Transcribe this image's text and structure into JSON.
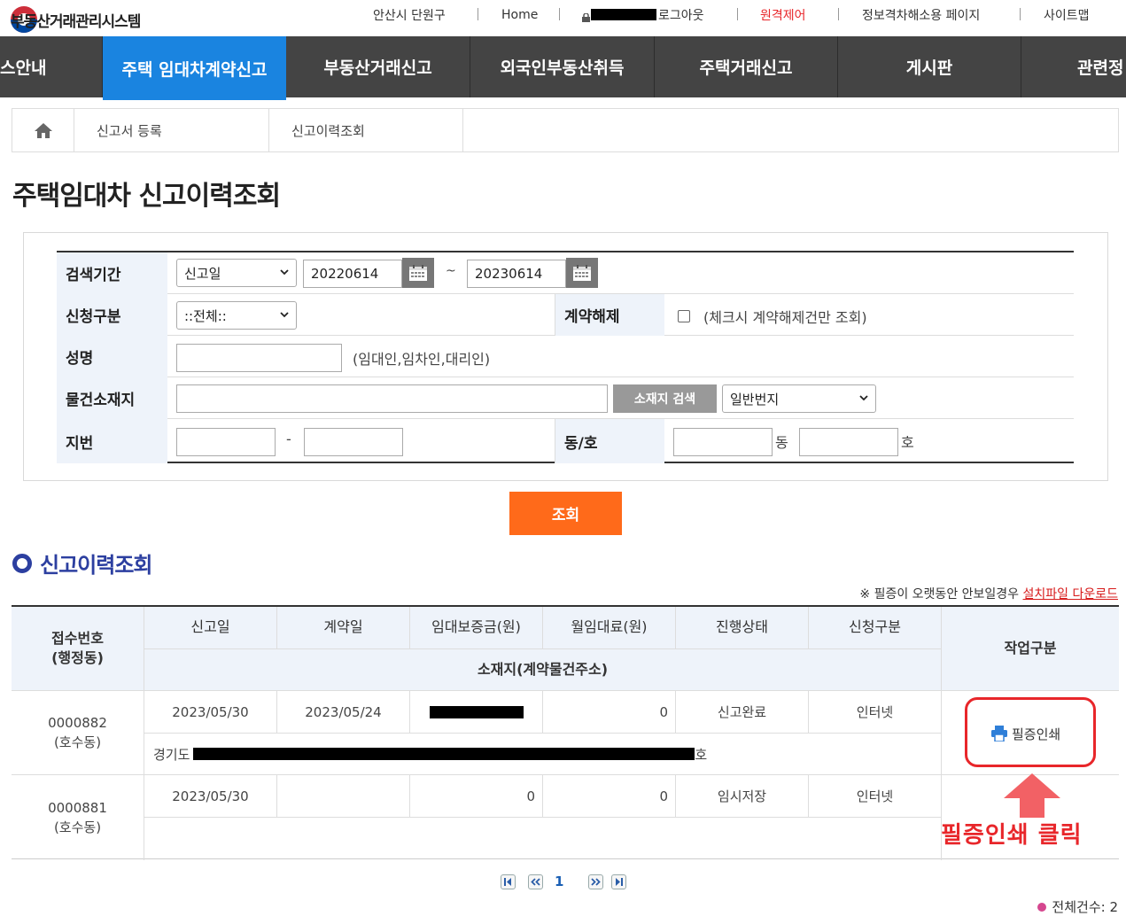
{
  "header": {
    "logo_text": "부동산거래관리시스템",
    "util": {
      "region": "안산시 단원구",
      "home": "Home",
      "logout": "로그아웃",
      "remote": "원격제어",
      "accessibility": "정보격차해소용 페이지",
      "sitemap": "사이트맵"
    },
    "colors": {
      "remote": "#e8262a"
    }
  },
  "nav": {
    "items": [
      {
        "label": "스안내"
      },
      {
        "label": "주택 임대차계약신고",
        "active": true
      },
      {
        "label": "부동산거래신고"
      },
      {
        "label": "외국인부동산취득"
      },
      {
        "label": "주택거래신고"
      },
      {
        "label": "게시판"
      },
      {
        "label": "관련정"
      }
    ],
    "colors": {
      "bar": "#444444",
      "active": "#1a84e0"
    }
  },
  "breadcrumb": {
    "home_icon": "home-icon",
    "items": [
      "신고서 등록",
      "신고이력조회"
    ]
  },
  "page_title": "주택임대차 신고이력조회",
  "search": {
    "period_label": "검색기간",
    "period_type": "신고일",
    "date_from": "20220614",
    "date_sep": "~",
    "date_to": "20230614",
    "apply_type_label": "신청구분",
    "apply_type_value": "::전체::",
    "cancel_label": "계약해제",
    "cancel_hint": "(체크시 계약해제건만 조회)",
    "name_label": "성명",
    "name_hint": "(임대인,임차인,대리인)",
    "location_label": "물건소재지",
    "location_search_btn": "소재지 검색",
    "location_type": "일반번지",
    "lot_label": "지번",
    "lot_sep": "-",
    "dongho_label": "동/호",
    "dong_suffix": "동",
    "ho_suffix": "호",
    "query_button": "조회"
  },
  "history": {
    "title": "신고이력조회",
    "notice_prefix": "※ 필증이 오랫동안 안보일경우 ",
    "notice_link": "설치파일 다운로드",
    "columns": {
      "receipt_no": "접수번호",
      "receipt_no_sub": "(행정동)",
      "report_date": "신고일",
      "contract_date": "계약일",
      "deposit": "임대보증금(원)",
      "monthly_rent": "월임대료(원)",
      "status": "진행상태",
      "apply_type": "신청구분",
      "address": "소재지(계약물건주소)",
      "action": "작업구분"
    },
    "rows": [
      {
        "receipt_no": "0000882",
        "admin_dong": "(호수동)",
        "report_date": "2023/05/30",
        "contract_date": "2023/05/24",
        "deposit": "",
        "monthly_rent": "0",
        "status": "신고완료",
        "apply_type": "인터넷",
        "address_prefix": "경기도",
        "address_suffix": "호",
        "action": "필증인쇄"
      },
      {
        "receipt_no": "0000881",
        "admin_dong": "(호수동)",
        "report_date": "2023/05/30",
        "contract_date": "",
        "deposit": "0",
        "monthly_rent": "0",
        "status": "임시저장",
        "apply_type": "인터넷",
        "address_prefix": "",
        "address_suffix": "",
        "action": ""
      }
    ],
    "annotation": "필증인쇄 클릭",
    "pagination": {
      "current": "1"
    },
    "total": "전체건수: 2"
  },
  "colors": {
    "query_button": "#ff6a1a",
    "section_title": "#2c3fa0",
    "annotation": "#e8262a",
    "label_bg": "#eef3fa"
  }
}
